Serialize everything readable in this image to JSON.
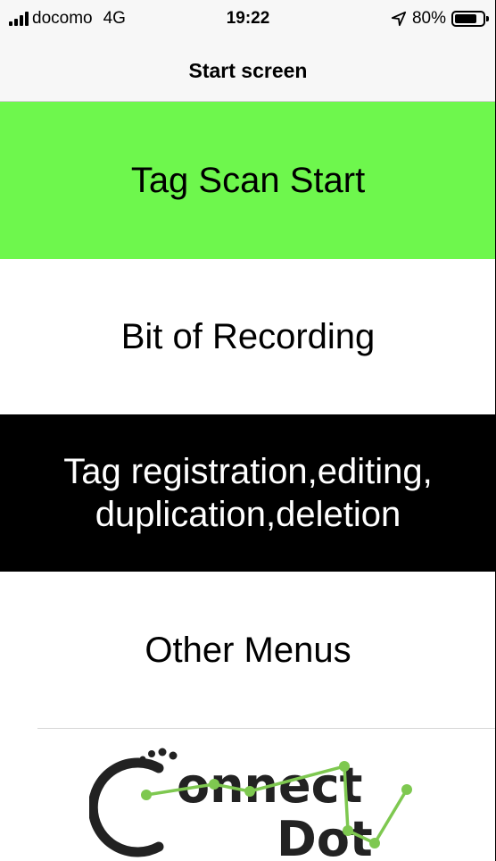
{
  "status_bar": {
    "carrier": "docomo",
    "network": "4G",
    "time": "19:22",
    "battery_percent": "80%",
    "battery_level": 0.8,
    "icons": [
      "signal-icon",
      "location-arrow-icon",
      "battery-icon"
    ]
  },
  "nav": {
    "title": "Start screen"
  },
  "menu": {
    "scan_label": "Tag Scan Start",
    "record_label": "Bit of Recording",
    "tag_line1": "Tag registration,editing,",
    "tag_line2": "duplication,deletion",
    "other_label": "Other Menus"
  },
  "logo": {
    "text_line1": "onnect",
    "text_line2": "Dot"
  },
  "colors": {
    "scan_bg": "#6ef74d",
    "tag_bg": "#000000",
    "bar_bg": "#f7f7f7",
    "logo_green": "#7ec850"
  }
}
